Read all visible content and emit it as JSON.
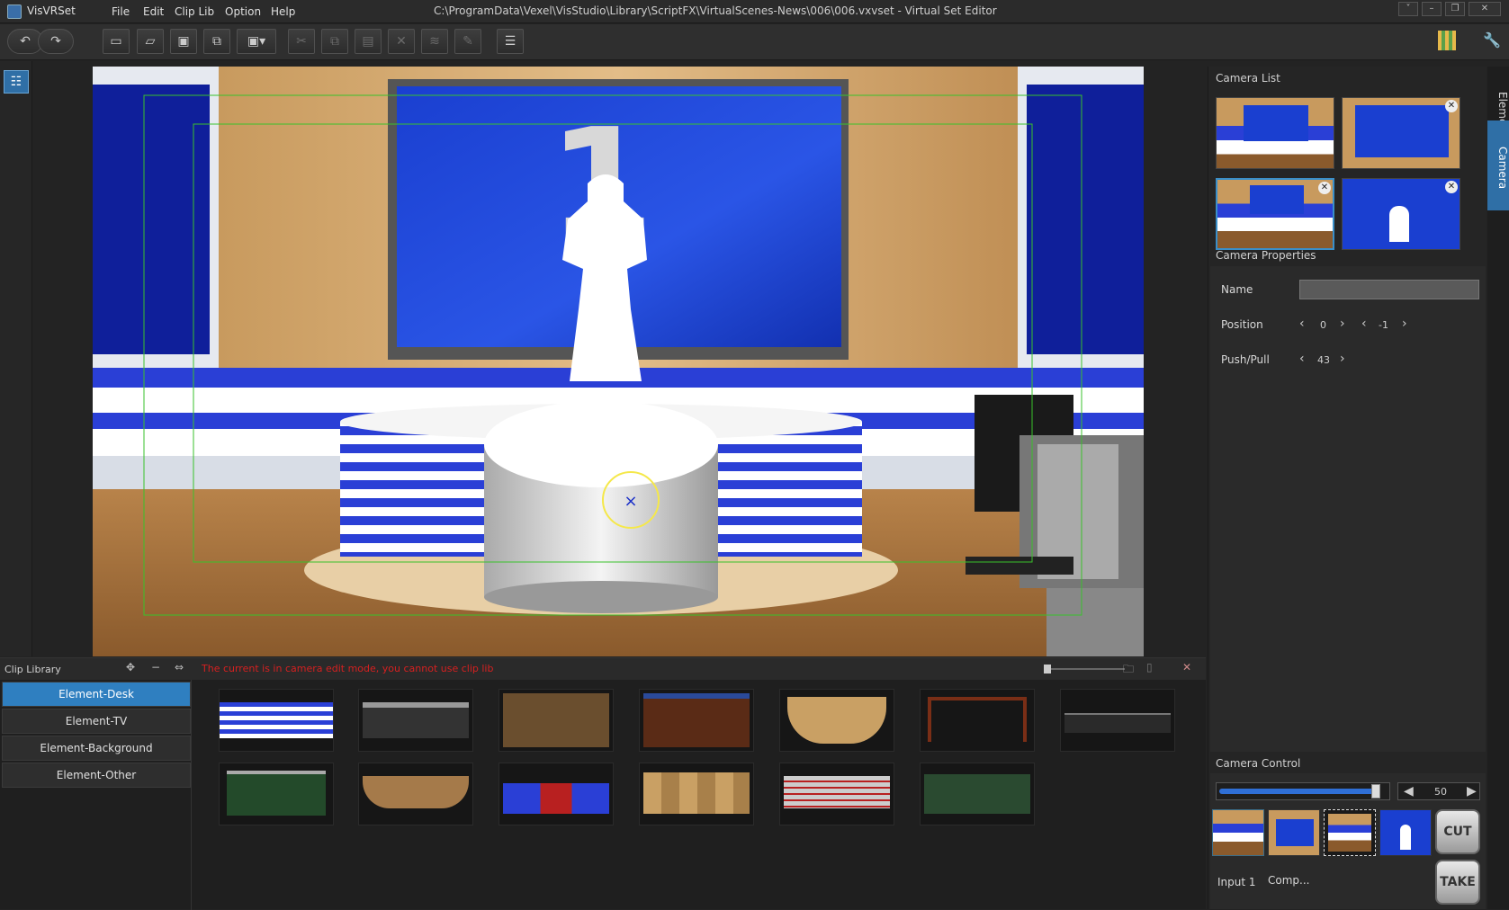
{
  "app": {
    "name": "VisVRSet",
    "window_title": "C:\\ProgramData\\Vexel\\VisStudio\\Library\\ScriptFX\\VirtualScenes-News\\006\\006.vxvset - Virtual Set Editor"
  },
  "menu": [
    "File",
    "Edit",
    "Clip Lib",
    "Option",
    "Help"
  ],
  "icons": {
    "undo": "undo-icon",
    "redo": "redo-icon",
    "new": "new-file-icon",
    "open": "open-folder-icon",
    "save": "save-icon",
    "save_as": "save-as-icon",
    "export": "export-icon",
    "cut": "cut-icon",
    "copy": "copy-icon",
    "paste": "paste-icon",
    "delete": "delete-icon",
    "list": "list-icon",
    "library": "library-icon",
    "wrench": "wrench-icon"
  },
  "viewport": {
    "big_number": "1",
    "safe_frame_color": "#39c22b",
    "cursor_ring_color": "#f5e84a"
  },
  "right_panel": {
    "camera_list_title": "Camera List",
    "camera_properties_title": "Camera Properties",
    "props": {
      "name_label": "Name",
      "name_value": "",
      "position_label": "Position",
      "position_x": "0",
      "position_y": "-1",
      "pushpull_label": "Push/Pull",
      "pushpull_value": "43"
    },
    "camera_control_title": "Camera Control",
    "slider_value": "50",
    "slider_fraction": 0.98,
    "input_labels": [
      "Input 1",
      "Comp..."
    ],
    "cut_label": "CUT",
    "take_label": "TAKE"
  },
  "vertical_tabs": [
    "Element",
    "Camera"
  ],
  "clip_library": {
    "title": "Clip Library",
    "warning": "The current is in camera edit mode, you cannot use clip lib",
    "categories": [
      "Element-Desk",
      "Element-TV",
      "Element-Background",
      "Element-Other"
    ],
    "active_category": "Element-Desk",
    "warning_color": "#d62020",
    "accent": "#2f7fc0"
  }
}
